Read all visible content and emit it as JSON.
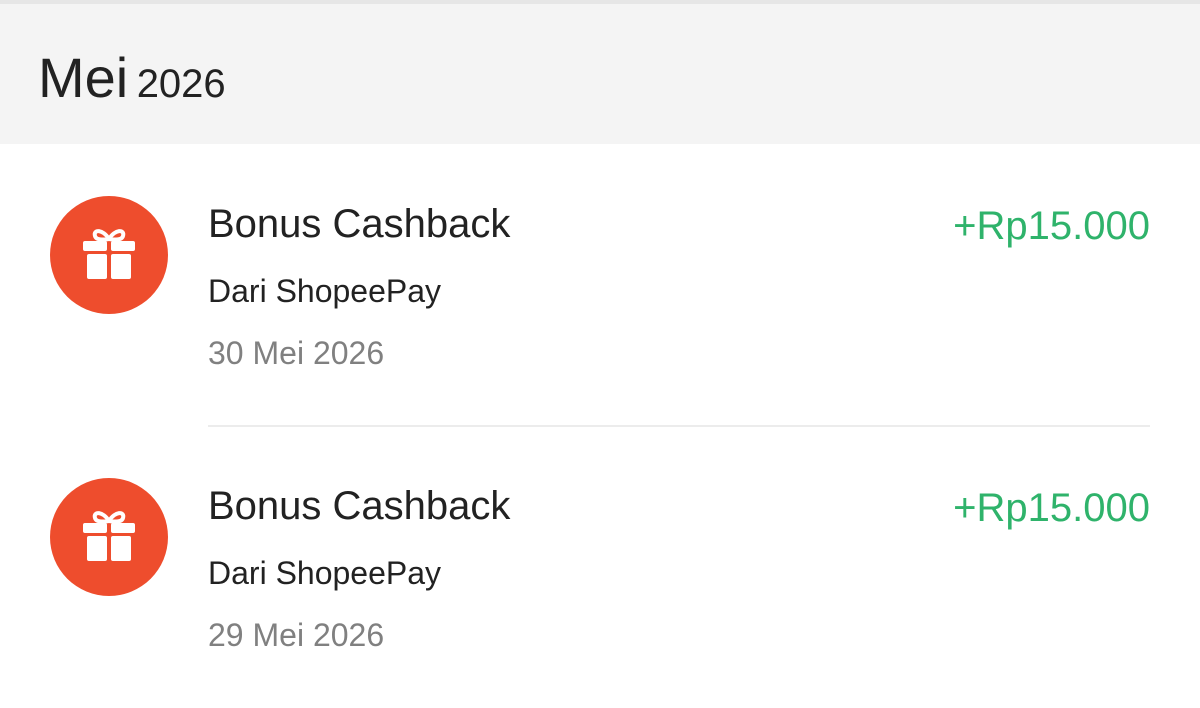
{
  "month_header": {
    "month": "Mei",
    "year": "2026"
  },
  "colors": {
    "accent": "#ee4d2d",
    "positive_amount": "#2fb36b",
    "header_bg": "#f4f4f4"
  },
  "transactions": [
    {
      "icon": "gift-icon",
      "title": "Bonus Cashback",
      "source": "Dari ShopeePay",
      "date": "30 Mei 2026",
      "amount": "+Rp15.000"
    },
    {
      "icon": "gift-icon",
      "title": "Bonus Cashback",
      "source": "Dari ShopeePay",
      "date": "29 Mei 2026",
      "amount": "+Rp15.000"
    }
  ]
}
